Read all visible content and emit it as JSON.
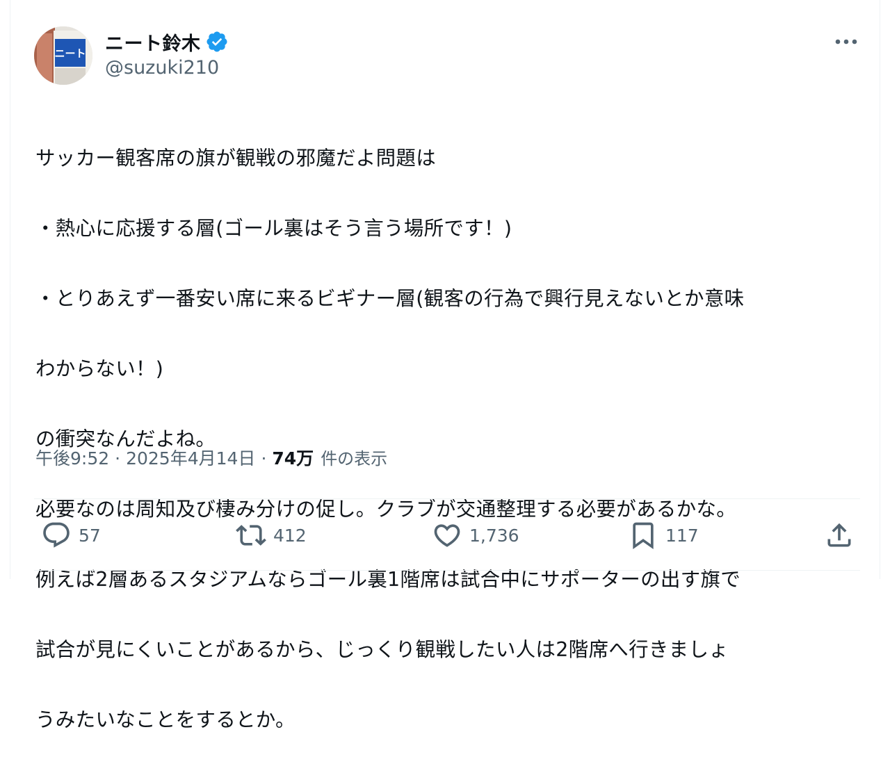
{
  "author": {
    "display_name": "ニート鈴木",
    "handle": "@suzuki210",
    "avatar_sign_text": "ニート",
    "verified": true
  },
  "tweet": {
    "lines": [
      "サッカー観客席の旗が観戦の邪魔だよ問題は",
      "・熱心に応援する層(ゴール裏はそう言う場所です！)",
      "・とりあえず一番安い席に来るビギナー層(観客の行為で興行見えないとか意味",
      "わからない！)",
      "の衝突なんだよね。",
      "必要なのは周知及び棲み分けの促し。クラブが交通整理する必要があるかな。",
      "例えば2層あるスタジアムならゴール裏1階席は試合中にサポーターの出す旗で",
      "試合が見にくいことがあるから、じっくり観戦したい人は2階席へ行きましょ",
      "うみたいなことをするとか。"
    ]
  },
  "meta": {
    "time": "午後9:52",
    "separator": "·",
    "date": "2025年4月14日",
    "views_count": "74万",
    "views_label": "件の表示"
  },
  "actions": {
    "reply_count": "57",
    "retweet_count": "412",
    "like_count": "1,736",
    "bookmark_count": "117"
  },
  "colors": {
    "text": "#0f1419",
    "secondary": "#536471",
    "verified": "#1d9bf0",
    "divider": "#eff3f4"
  },
  "icons": [
    "verified-badge-icon",
    "more-icon",
    "reply-icon",
    "retweet-icon",
    "like-icon",
    "bookmark-icon",
    "share-icon"
  ]
}
